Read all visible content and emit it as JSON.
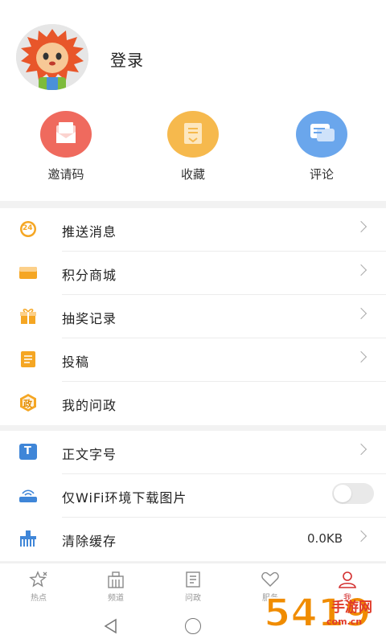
{
  "profile": {
    "login_label": "登录"
  },
  "quick_actions": [
    {
      "label": "邀请码",
      "icon": "invite-envelope-icon",
      "color": "#ef6a5e"
    },
    {
      "label": "收藏",
      "icon": "favorite-bookmark-icon",
      "color": "#f6b94d"
    },
    {
      "label": "评论",
      "icon": "comment-bubble-icon",
      "color": "#6aa6ec"
    }
  ],
  "menu_group1": [
    {
      "label": "推送消息",
      "icon": "push-24-icon"
    },
    {
      "label": "积分商城",
      "icon": "points-mall-icon"
    },
    {
      "label": "抽奖记录",
      "icon": "gift-icon"
    },
    {
      "label": "投稿",
      "icon": "submission-icon"
    },
    {
      "label": "我的问政",
      "icon": "inquiry-icon",
      "badge": "政"
    }
  ],
  "menu_group2": [
    {
      "label": "正文字号",
      "icon": "font-size-icon",
      "badge": "T"
    },
    {
      "label": "仅WiFi环境下载图片",
      "icon": "wifi-icon",
      "toggle": false
    },
    {
      "label": "清除缓存",
      "icon": "clear-cache-icon",
      "value": "0.0KB"
    }
  ],
  "push_badge": "24",
  "tabs": [
    {
      "label": "热点",
      "icon": "hotspot-icon",
      "active": false
    },
    {
      "label": "频道",
      "icon": "channel-icon",
      "active": false
    },
    {
      "label": "问政",
      "icon": "inquiry-tab-icon",
      "active": false
    },
    {
      "label": "服务",
      "icon": "service-icon",
      "active": false
    },
    {
      "label": "我",
      "icon": "me-icon",
      "active": true
    }
  ],
  "watermark": {
    "number": "5419",
    "site_name": "手游网",
    "url": "com.cn"
  },
  "colors": {
    "accent": "#d32f2f",
    "orange": "#f5a623"
  }
}
